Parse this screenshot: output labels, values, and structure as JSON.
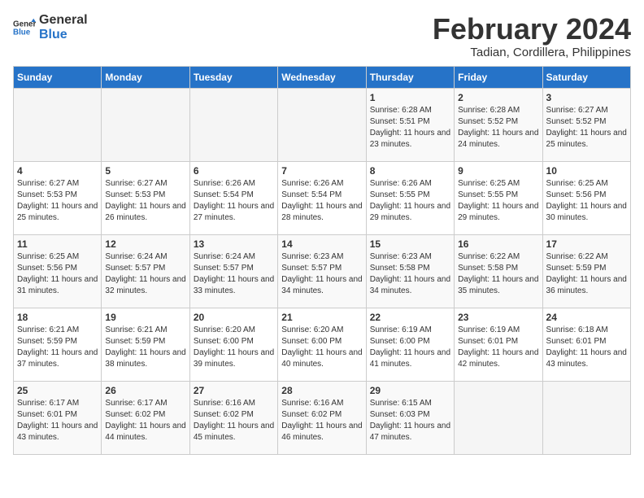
{
  "logo": {
    "line1": "General",
    "line2": "Blue"
  },
  "title": {
    "month_year": "February 2024",
    "location": "Tadian, Cordillera, Philippines"
  },
  "headers": [
    "Sunday",
    "Monday",
    "Tuesday",
    "Wednesday",
    "Thursday",
    "Friday",
    "Saturday"
  ],
  "weeks": [
    [
      {
        "day": "",
        "info": ""
      },
      {
        "day": "",
        "info": ""
      },
      {
        "day": "",
        "info": ""
      },
      {
        "day": "",
        "info": ""
      },
      {
        "day": "1",
        "info": "Sunrise: 6:28 AM\nSunset: 5:51 PM\nDaylight: 11 hours and 23 minutes."
      },
      {
        "day": "2",
        "info": "Sunrise: 6:28 AM\nSunset: 5:52 PM\nDaylight: 11 hours and 24 minutes."
      },
      {
        "day": "3",
        "info": "Sunrise: 6:27 AM\nSunset: 5:52 PM\nDaylight: 11 hours and 25 minutes."
      }
    ],
    [
      {
        "day": "4",
        "info": "Sunrise: 6:27 AM\nSunset: 5:53 PM\nDaylight: 11 hours and 25 minutes."
      },
      {
        "day": "5",
        "info": "Sunrise: 6:27 AM\nSunset: 5:53 PM\nDaylight: 11 hours and 26 minutes."
      },
      {
        "day": "6",
        "info": "Sunrise: 6:26 AM\nSunset: 5:54 PM\nDaylight: 11 hours and 27 minutes."
      },
      {
        "day": "7",
        "info": "Sunrise: 6:26 AM\nSunset: 5:54 PM\nDaylight: 11 hours and 28 minutes."
      },
      {
        "day": "8",
        "info": "Sunrise: 6:26 AM\nSunset: 5:55 PM\nDaylight: 11 hours and 29 minutes."
      },
      {
        "day": "9",
        "info": "Sunrise: 6:25 AM\nSunset: 5:55 PM\nDaylight: 11 hours and 29 minutes."
      },
      {
        "day": "10",
        "info": "Sunrise: 6:25 AM\nSunset: 5:56 PM\nDaylight: 11 hours and 30 minutes."
      }
    ],
    [
      {
        "day": "11",
        "info": "Sunrise: 6:25 AM\nSunset: 5:56 PM\nDaylight: 11 hours and 31 minutes."
      },
      {
        "day": "12",
        "info": "Sunrise: 6:24 AM\nSunset: 5:57 PM\nDaylight: 11 hours and 32 minutes."
      },
      {
        "day": "13",
        "info": "Sunrise: 6:24 AM\nSunset: 5:57 PM\nDaylight: 11 hours and 33 minutes."
      },
      {
        "day": "14",
        "info": "Sunrise: 6:23 AM\nSunset: 5:57 PM\nDaylight: 11 hours and 34 minutes."
      },
      {
        "day": "15",
        "info": "Sunrise: 6:23 AM\nSunset: 5:58 PM\nDaylight: 11 hours and 34 minutes."
      },
      {
        "day": "16",
        "info": "Sunrise: 6:22 AM\nSunset: 5:58 PM\nDaylight: 11 hours and 35 minutes."
      },
      {
        "day": "17",
        "info": "Sunrise: 6:22 AM\nSunset: 5:59 PM\nDaylight: 11 hours and 36 minutes."
      }
    ],
    [
      {
        "day": "18",
        "info": "Sunrise: 6:21 AM\nSunset: 5:59 PM\nDaylight: 11 hours and 37 minutes."
      },
      {
        "day": "19",
        "info": "Sunrise: 6:21 AM\nSunset: 5:59 PM\nDaylight: 11 hours and 38 minutes."
      },
      {
        "day": "20",
        "info": "Sunrise: 6:20 AM\nSunset: 6:00 PM\nDaylight: 11 hours and 39 minutes."
      },
      {
        "day": "21",
        "info": "Sunrise: 6:20 AM\nSunset: 6:00 PM\nDaylight: 11 hours and 40 minutes."
      },
      {
        "day": "22",
        "info": "Sunrise: 6:19 AM\nSunset: 6:00 PM\nDaylight: 11 hours and 41 minutes."
      },
      {
        "day": "23",
        "info": "Sunrise: 6:19 AM\nSunset: 6:01 PM\nDaylight: 11 hours and 42 minutes."
      },
      {
        "day": "24",
        "info": "Sunrise: 6:18 AM\nSunset: 6:01 PM\nDaylight: 11 hours and 43 minutes."
      }
    ],
    [
      {
        "day": "25",
        "info": "Sunrise: 6:17 AM\nSunset: 6:01 PM\nDaylight: 11 hours and 43 minutes."
      },
      {
        "day": "26",
        "info": "Sunrise: 6:17 AM\nSunset: 6:02 PM\nDaylight: 11 hours and 44 minutes."
      },
      {
        "day": "27",
        "info": "Sunrise: 6:16 AM\nSunset: 6:02 PM\nDaylight: 11 hours and 45 minutes."
      },
      {
        "day": "28",
        "info": "Sunrise: 6:16 AM\nSunset: 6:02 PM\nDaylight: 11 hours and 46 minutes."
      },
      {
        "day": "29",
        "info": "Sunrise: 6:15 AM\nSunset: 6:03 PM\nDaylight: 11 hours and 47 minutes."
      },
      {
        "day": "",
        "info": ""
      },
      {
        "day": "",
        "info": ""
      }
    ]
  ]
}
